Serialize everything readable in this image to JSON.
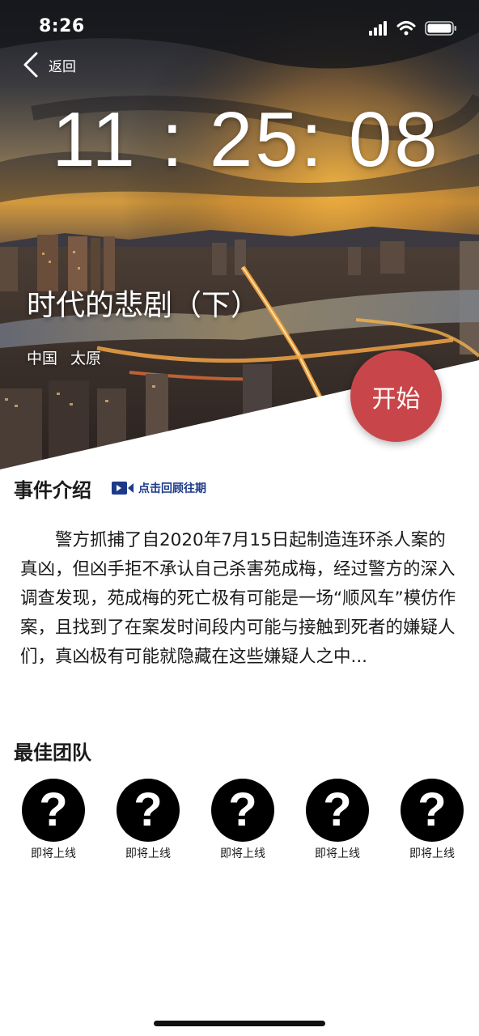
{
  "status_bar": {
    "time": "8:26"
  },
  "nav": {
    "back_label": "返回"
  },
  "hero": {
    "timer": "11 : 25: 08",
    "title": "时代的悲剧（下）",
    "location": [
      "中国",
      "太原"
    ],
    "start_label": "开始"
  },
  "event": {
    "title": "事件介绍",
    "review_label": "点击回顾往期",
    "body": "警方抓捕了自2020年7月15日起制造连环杀人案的真凶，但凶手拒不承认自己杀害苑成梅，经过警方的深入调查发现，苑成梅的死亡极有可能是一场“顺风车”模仿作案，且找到了在案发时间段内可能与接触到死者的嫌疑人们，真凶极有可能就隐藏在这些嫌疑人之中..."
  },
  "team": {
    "title": "最佳团队",
    "members": [
      {
        "avatar": "?",
        "label": "即将上线"
      },
      {
        "avatar": "?",
        "label": "即将上线"
      },
      {
        "avatar": "?",
        "label": "即将上线"
      },
      {
        "avatar": "?",
        "label": "即将上线"
      },
      {
        "avatar": "?",
        "label": "即将上线"
      }
    ]
  },
  "colors": {
    "start_button": "#c8464a",
    "review_link": "#1d3a8a",
    "text": "#1a1a1a"
  },
  "icons": {
    "back": "chevron-left-icon",
    "review": "video-camera-icon",
    "status": [
      "signal-icon",
      "wifi-icon",
      "battery-icon"
    ]
  }
}
